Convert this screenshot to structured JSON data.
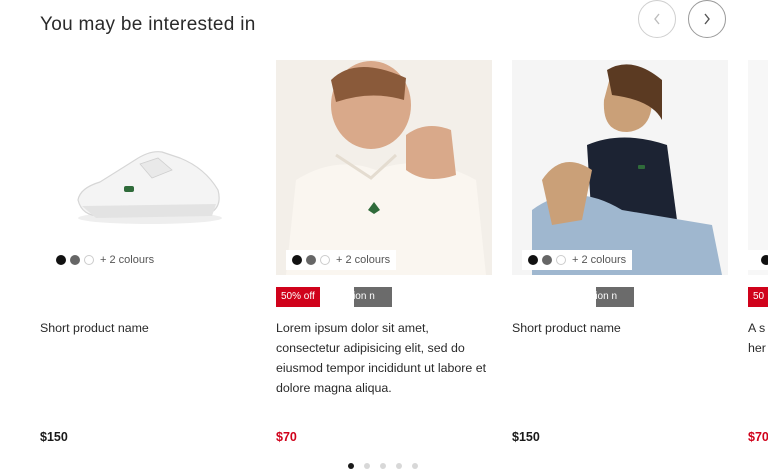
{
  "section": {
    "title": "You may be interested in"
  },
  "colors": {
    "sale": "#d0021b",
    "collection": "#6b6b6b"
  },
  "products": [
    {
      "name": "Short product name",
      "price": "$150",
      "colours_more": "+ 2 colours",
      "sale_badge": "",
      "collection_badge": ""
    },
    {
      "name": "Lorem ipsum dolor sit amet, consectetur adipisicing elit, sed do eiusmod tempor incididunt ut labore et dolore magna aliqua.",
      "price": "$70",
      "colours_more": "+ 2 colours",
      "sale_badge": "50% off",
      "collection_badge": "ection n"
    },
    {
      "name": "Short product name",
      "price": "$150",
      "colours_more": "+ 2 colours",
      "sale_badge": "",
      "collection_badge": "ection n"
    },
    {
      "name": "A s her",
      "price": "$70",
      "colours_more": "",
      "sale_badge": "50",
      "collection_badge": ""
    }
  ],
  "pagination": {
    "pages": 5,
    "current": 1
  },
  "icons": {
    "prev": "chevron-left-icon",
    "next": "chevron-right-icon"
  }
}
